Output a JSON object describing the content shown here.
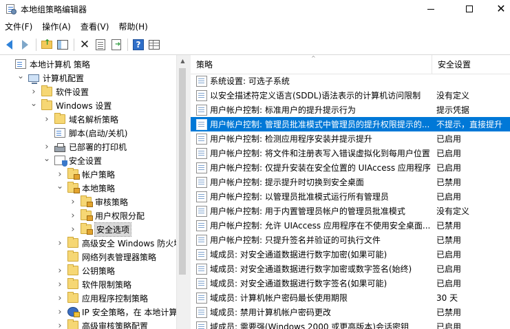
{
  "window": {
    "title": "本地组策略编辑器"
  },
  "menu": [
    {
      "label": "文件(F)"
    },
    {
      "label": "操作(A)"
    },
    {
      "label": "查看(V)"
    },
    {
      "label": "帮助(H)"
    }
  ],
  "tree": {
    "items": [
      {
        "label": "本地计算机 策略",
        "icon": "policy-doc-icon",
        "expander": "none",
        "indent": 0
      },
      {
        "label": "计算机配置",
        "icon": "computer-icon",
        "expander": "expanded",
        "indent": 1
      },
      {
        "label": "软件设置",
        "icon": "folder-icon",
        "expander": "collapsed",
        "indent": 2
      },
      {
        "label": "Windows 设置",
        "icon": "folder-icon",
        "expander": "expanded",
        "indent": 2
      },
      {
        "label": "域名解析策略",
        "icon": "folder-icon",
        "expander": "collapsed",
        "indent": 3
      },
      {
        "label": "脚本(启动/关机)",
        "icon": "policy-doc-icon",
        "expander": "none",
        "indent": 3
      },
      {
        "label": "已部署的打印机",
        "icon": "printer-icon",
        "expander": "collapsed",
        "indent": 3
      },
      {
        "label": "安全设置",
        "icon": "security-settings-icon",
        "expander": "expanded",
        "indent": 3
      },
      {
        "label": "帐户策略",
        "icon": "locked-folder-icon",
        "expander": "collapsed",
        "indent": 4
      },
      {
        "label": "本地策略",
        "icon": "locked-folder-icon",
        "expander": "expanded",
        "indent": 4
      },
      {
        "label": "审核策略",
        "icon": "locked-folder-icon",
        "expander": "collapsed",
        "indent": 5
      },
      {
        "label": "用户权限分配",
        "icon": "locked-folder-icon",
        "expander": "collapsed",
        "indent": 5
      },
      {
        "label": "安全选项",
        "icon": "locked-folder-icon",
        "expander": "collapsed",
        "indent": 5,
        "selected": true
      },
      {
        "label": "高级安全 Windows 防火墙",
        "icon": "folder-icon",
        "expander": "collapsed",
        "indent": 4
      },
      {
        "label": "网络列表管理器策略",
        "icon": "folder-icon",
        "expander": "none",
        "indent": 4
      },
      {
        "label": "公钥策略",
        "icon": "folder-icon",
        "expander": "collapsed",
        "indent": 4
      },
      {
        "label": "软件限制策略",
        "icon": "folder-icon",
        "expander": "collapsed",
        "indent": 4
      },
      {
        "label": "应用程序控制策略",
        "icon": "folder-icon",
        "expander": "collapsed",
        "indent": 4
      },
      {
        "label": "IP 安全策略，在 本地计算机",
        "icon": "ip-security-icon",
        "expander": "collapsed",
        "indent": 4
      },
      {
        "label": "高级审核策略配置",
        "icon": "folder-icon",
        "expander": "collapsed",
        "indent": 4
      }
    ]
  },
  "list": {
    "columns": {
      "policy": "策略",
      "setting": "安全设置"
    },
    "rows": [
      {
        "policy": "系统设置: 可选子系统",
        "setting": ""
      },
      {
        "policy": "以安全描述符定义语言(SDDL)语法表示的计算机访问限制",
        "setting": "没有定义"
      },
      {
        "policy": "用户帐户控制: 标准用户的提升提示行为",
        "setting": "提示凭据"
      },
      {
        "policy": "用户帐户控制: 管理员批准模式中管理员的提升权限提示的...",
        "setting": "不提示，直接提升",
        "selected": true
      },
      {
        "policy": "用户帐户控制: 检测应用程序安装并提示提升",
        "setting": "已启用"
      },
      {
        "policy": "用户帐户控制: 将文件和注册表写入错误虚拟化到每用户位置",
        "setting": "已启用"
      },
      {
        "policy": "用户帐户控制: 仅提升安装在安全位置的 UIAccess 应用程序",
        "setting": "已启用"
      },
      {
        "policy": "用户帐户控制: 提示提升时切换到安全桌面",
        "setting": "已禁用"
      },
      {
        "policy": "用户帐户控制: 以管理员批准模式运行所有管理员",
        "setting": "已启用"
      },
      {
        "policy": "用户帐户控制: 用于内置管理员帐户的管理员批准模式",
        "setting": "没有定义"
      },
      {
        "policy": "用户帐户控制: 允许 UIAccess 应用程序在不使用安全桌面...",
        "setting": "已禁用"
      },
      {
        "policy": "用户帐户控制: 只提升签名并验证的可执行文件",
        "setting": "已禁用"
      },
      {
        "policy": "域成员: 对安全通道数据进行数字加密(如果可能)",
        "setting": "已启用"
      },
      {
        "policy": "域成员: 对安全通道数据进行数字加密或数字签名(始终)",
        "setting": "已启用"
      },
      {
        "policy": "域成员: 对安全通道数据进行数字签名(如果可能)",
        "setting": "已启用"
      },
      {
        "policy": "域成员: 计算机帐户密码最长使用期限",
        "setting": "30 天"
      },
      {
        "policy": "域成员: 禁用计算机帐户密码更改",
        "setting": "已禁用"
      },
      {
        "policy": "域成员: 需要强(Windows 2000 或更高版本)会话密钥",
        "setting": "已启用"
      }
    ]
  },
  "colors": {
    "selection": "#0078d7",
    "tree_selection": "#d9d9d9"
  }
}
